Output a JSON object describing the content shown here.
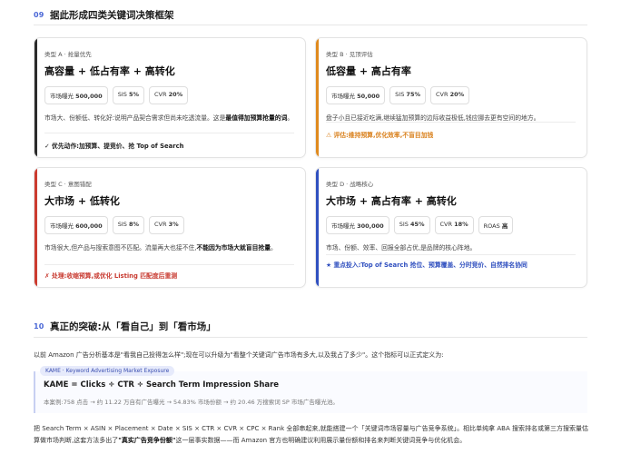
{
  "section9": {
    "number": "09",
    "title": "据此形成四类关键词决策框架"
  },
  "cards": [
    {
      "label": "类型 A · 抢量优先",
      "title": "高容量 + 低占有率 + 高转化",
      "chips": [
        {
          "k": "市场曝光",
          "v": "500,000"
        },
        {
          "k": "SIS",
          "v": "5%"
        },
        {
          "k": "CVR",
          "v": "20%"
        }
      ],
      "desc_pre": "市场大、份额低、转化好:说明产品契合需求但尚未吃透流量。这是",
      "desc_bold": "最值得加预算抢量的词",
      "desc_post": "。",
      "foot": "✓ 优先动作:加预算、提竞价、抢 Top of Search",
      "accent": "#2b2b2b",
      "foot_color": "#222222"
    },
    {
      "label": "类型 B · 见顶评估",
      "title": "低容量 + 高占有率",
      "chips": [
        {
          "k": "市场曝光",
          "v": "50,000"
        },
        {
          "k": "SIS",
          "v": "75%"
        },
        {
          "k": "CVR",
          "v": "20%"
        }
      ],
      "desc_pre": "盘子小且已接近吃满,继续猛加预算的边际收益极低,钱应挪去更有空间的地方。",
      "desc_bold": "",
      "desc_post": "",
      "foot": "⚠ 评估:维持预算,优化效率,不盲目加钱",
      "accent": "#e08a1e",
      "foot_color": "#d9801c"
    },
    {
      "label": "类型 C · 意图错配",
      "title": "大市场 + 低转化",
      "chips": [
        {
          "k": "市场曝光",
          "v": "600,000"
        },
        {
          "k": "SIS",
          "v": "8%"
        },
        {
          "k": "CVR",
          "v": "3%"
        }
      ],
      "desc_pre": "市场很大,但产品与搜索意图不匹配。流量再大也接不住,",
      "desc_bold": "不能因为市场大就盲目抢量",
      "desc_post": "。",
      "foot": "✗ 处理:收缩预算,或优化 Listing 匹配度后重测",
      "accent": "#cc3b2f",
      "foot_color": "#c83a30"
    },
    {
      "label": "类型 D · 战略核心",
      "title": "大市场 + 高占有率 + 高转化",
      "chips": [
        {
          "k": "市场曝光",
          "v": "300,000"
        },
        {
          "k": "SIS",
          "v": "45%"
        },
        {
          "k": "CVR",
          "v": "18%"
        },
        {
          "k": "ROAS",
          "v": "高"
        }
      ],
      "desc_pre": "市场、份额、效率、回报全部占优,是品牌的核心阵地。",
      "desc_bold": "",
      "desc_post": "",
      "foot": "★ 重点投入:Top of Search 抢位、预算覆盖、分时竞价、自然排名协同",
      "accent": "#3050c0",
      "foot_color": "#2f4fbf"
    }
  ],
  "section10": {
    "number": "10",
    "title": "真正的突破:从「看自己」到「看市场」"
  },
  "intro": "以前 Amazon 广告分析基本是\"看我自己投得怎么样\";现在可以升级为\"看整个关键词广告市场有多大,以及我占了多少\"。这个指标可以正式定义为:",
  "formula": {
    "tag": "KAME · Keyword Advertising Market Exposure",
    "expr": "KAME = Clicks ÷ CTR ÷ Search Term Impression Share",
    "example": "本案例:758 点击 → 约 11.22 万自有广告曝光 → 54.83% 市场份额 → 约 20.46 万搜索词 SP 市场广告曝光池。"
  },
  "para": {
    "pre": "把 Search Term × ASIN × Placement × Date × SIS × CTR × CVR × CPC × Rank 全部串起来,就能搭建一个「关键词市场容量与广告竞争系统」。相比单纯拿 ABA 搜索排名或第三方搜索量估算做市场判断,这套方法多出了",
    "bold": "\"真实广告竞争份额\"",
    "post": "这一层事实数据——而 Amazon 官方也明确建议利用展示量份额和排名来判断关键词竞争与优化机会。"
  }
}
